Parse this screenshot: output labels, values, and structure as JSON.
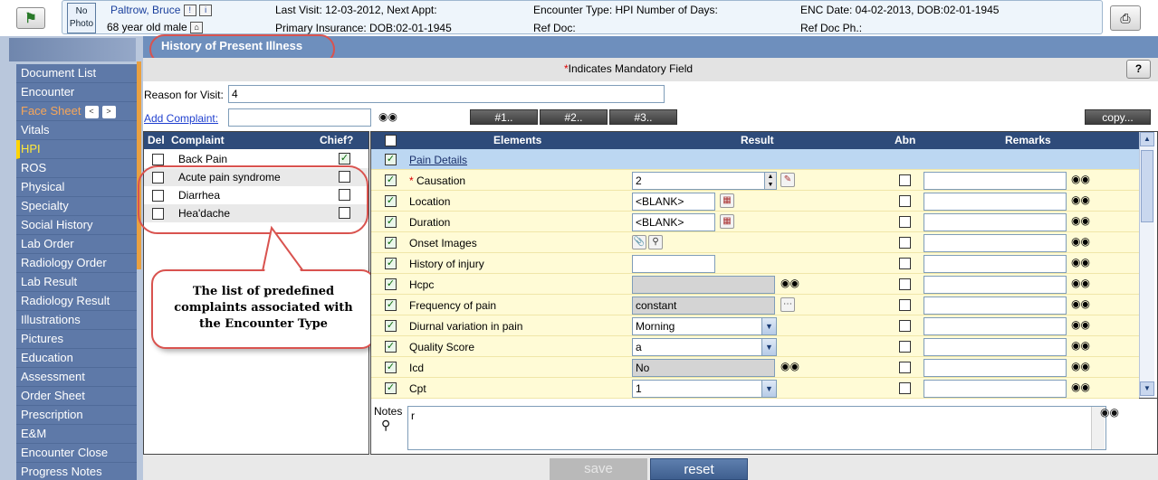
{
  "header": {
    "photo_label": "No Photo",
    "patient_name": "Paltrow, Bruce",
    "patient_desc": "68 year old male",
    "last_visit": "Last Visit: 12-03-2012, Next Appt:",
    "primary_insurance": "Primary Insurance: DOB:02-01-1945",
    "encounter_type": "Encounter Type: HPI Number of Days:",
    "ref_doc": "Ref Doc:",
    "enc_date": "ENC Date: 04-02-2013, DOB:02-01-1945",
    "ref_doc_ph": "Ref Doc Ph.:"
  },
  "sidebar": {
    "items": [
      {
        "label": "Document List"
      },
      {
        "label": "Encounter"
      },
      {
        "label": "Face Sheet"
      },
      {
        "label": "Vitals"
      },
      {
        "label": "HPI"
      },
      {
        "label": "ROS"
      },
      {
        "label": "Physical"
      },
      {
        "label": "Specialty"
      },
      {
        "label": "Social History"
      },
      {
        "label": "Lab Order"
      },
      {
        "label": "Radiology Order"
      },
      {
        "label": "Lab Result"
      },
      {
        "label": "Radiology Result"
      },
      {
        "label": "Illustrations"
      },
      {
        "label": "Pictures"
      },
      {
        "label": "Education"
      },
      {
        "label": "Assessment"
      },
      {
        "label": "Order Sheet"
      },
      {
        "label": "Prescription"
      },
      {
        "label": "E&M"
      },
      {
        "label": "Encounter Close"
      },
      {
        "label": "Progress Notes"
      }
    ],
    "prev_arrow": "<",
    "next_arrow": ">"
  },
  "page": {
    "title": "History of Present Illness",
    "mandatory_star": "*",
    "mandatory_note": "Indicates Mandatory Field",
    "help_label": "?",
    "reason_label": "Reason for Visit:",
    "reason_value": "4",
    "add_complaint_label": "Add Complaint:",
    "add_complaint_value": "",
    "num_buttons": [
      "#1..",
      "#2..",
      "#3.."
    ],
    "copy_label": "copy...",
    "save_label": "save",
    "reset_label": "reset",
    "notes_label": "Notes",
    "notes_value": "r"
  },
  "complaints": {
    "headers": {
      "del": "Del",
      "complaint": "Complaint",
      "chief": "Chief?"
    },
    "rows": [
      {
        "name": "Back Pain",
        "del": false,
        "chief": true
      },
      {
        "name": "Acute pain syndrome",
        "del": false,
        "chief": false
      },
      {
        "name": "Diarrhea",
        "del": false,
        "chief": false
      },
      {
        "name": "Hea'dache",
        "del": false,
        "chief": false
      }
    ]
  },
  "callout": {
    "line1": "The list of predefined",
    "line2": "complaints associated with",
    "line3": "the Encounter Type"
  },
  "elements": {
    "headers": {
      "elements": "Elements",
      "result": "Result",
      "abn": "Abn",
      "remarks": "Remarks"
    },
    "section": "Pain Details",
    "rows": [
      {
        "name": "Causation",
        "mandatory": true,
        "result": "2",
        "type": "spinner"
      },
      {
        "name": "Location",
        "result": "<BLANK>",
        "type": "picker"
      },
      {
        "name": "Duration",
        "result": "<BLANK>",
        "type": "picker"
      },
      {
        "name": "Onset Images",
        "result": "",
        "type": "images"
      },
      {
        "name": "History of injury",
        "result": "",
        "type": "text"
      },
      {
        "name": "Hcpc",
        "result": "",
        "type": "lookup"
      },
      {
        "name": "Frequency of pain",
        "result": "constant",
        "type": "ellipsis"
      },
      {
        "name": "Diurnal variation in pain",
        "result": "Morning",
        "type": "select"
      },
      {
        "name": "Quality Score",
        "result": "a",
        "type": "select"
      },
      {
        "name": "Icd",
        "result": "No",
        "type": "lookup"
      },
      {
        "name": "Cpt",
        "result": "1",
        "type": "select"
      }
    ]
  },
  "colors": {
    "sidebar_item": "#5e79a8",
    "header_blue": "#2e4b7a",
    "annotation_red": "#d9534f",
    "row_yellow": "#fffbd6"
  }
}
